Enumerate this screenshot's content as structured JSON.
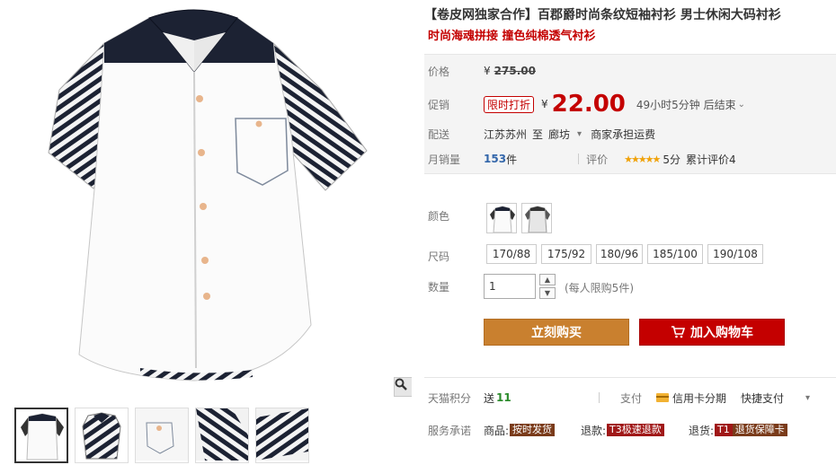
{
  "title_line": "【卷皮网独家合作】百郡爵时尚条纹短袖衬衫 男士休闲大码衬衫",
  "subtitle": "时尚海魂拼接 撞色纯棉透气衬衫",
  "price": {
    "label": "价格",
    "currency": "¥",
    "original": "275.00"
  },
  "promo": {
    "label": "促销",
    "tag": "限时打折",
    "currency": "¥",
    "value": "22.00",
    "countdown": "49小时5分钟 后结束",
    "chevron": "⌄"
  },
  "shipping": {
    "label": "配送",
    "from": "江苏苏州",
    "to_word": "至",
    "dest": "廊坊",
    "dest_chevron": "▾",
    "fee": "商家承担运费"
  },
  "sales": {
    "label": "月销量",
    "count": "153",
    "unit": "件",
    "rating_label": "评价",
    "stars": "★★★★★",
    "score": "5分",
    "cumulative": "累计评价4"
  },
  "color": {
    "label": "颜色",
    "options": [
      "white-navy",
      "grey-stripe"
    ]
  },
  "size": {
    "label": "尺码",
    "options": [
      "170/88",
      "175/92",
      "180/96",
      "185/100",
      "190/108"
    ]
  },
  "quantity": {
    "label": "数量",
    "value": "1",
    "limit": "(每人限购5件)"
  },
  "buttons": {
    "buy_now": "立刻购买",
    "add_cart": "加入购物车"
  },
  "points": {
    "label": "天猫积分",
    "send": "送",
    "amount": "11",
    "pay_label": "支付",
    "credit": "信用卡分期",
    "quick": "快捷支付",
    "quick_chevron": "▾"
  },
  "service": {
    "label": "服务承诺",
    "goods": "商品:",
    "goods_badge": "按时发货",
    "refund": "退款:",
    "refund_badge": "T3极速退款",
    "return": "退货:",
    "return_badge_tag": "T1",
    "return_badge": "退货保障卡"
  },
  "icons": {
    "zoom": "magnifier-icon",
    "cart": "cart-icon",
    "card": "credit-card-icon"
  },
  "colors": {
    "accent_red": "#c40000",
    "buy_orange": "#c9802f",
    "star": "#f0a20a",
    "points_green": "#2a8a2a"
  }
}
